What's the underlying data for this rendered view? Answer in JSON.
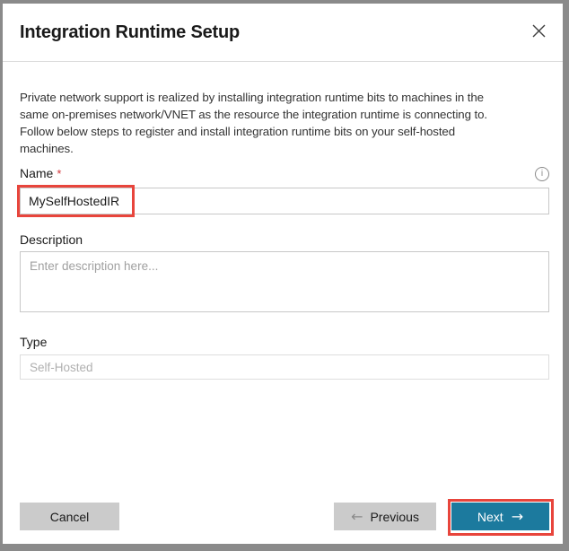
{
  "dialog": {
    "title": "Integration Runtime Setup"
  },
  "intro": {
    "lines": [
      "Private network support is realized by installing integration runtime bits to machines in the",
      "same on-premises network/VNET as the resource the integration runtime is connecting to.",
      "Follow below steps to register and install integration runtime bits on your self-hosted",
      "machines."
    ]
  },
  "fields": {
    "name": {
      "label": "Name",
      "required_marker": "*",
      "value": "MySelfHostedIR"
    },
    "description": {
      "label": "Description",
      "placeholder": "Enter description here..."
    },
    "type": {
      "label": "Type",
      "value": "Self-Hosted"
    }
  },
  "footer": {
    "cancel_label": "Cancel",
    "previous_label": "Previous",
    "next_label": "Next"
  },
  "icons": {
    "info": "i",
    "back_arrow": "←",
    "next_arrow": "→"
  },
  "colors": {
    "accent_teal": "#1c7a9e",
    "annotation_red": "#e8453c",
    "button_gray": "#cbcbcb",
    "required_red": "#d13438"
  }
}
